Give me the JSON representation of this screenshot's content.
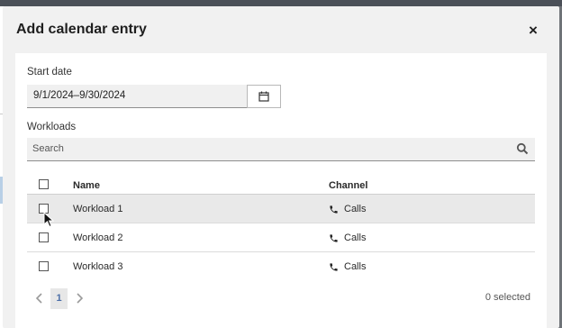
{
  "dialog": {
    "title": "Add calendar entry",
    "close_label": "×"
  },
  "start_date": {
    "label": "Start date",
    "value": "9/1/2024–9/30/2024"
  },
  "workloads": {
    "label": "Workloads",
    "search_placeholder": "Search"
  },
  "table": {
    "headers": {
      "name": "Name",
      "channel": "Channel"
    },
    "rows": [
      {
        "name": "Workload 1",
        "channel": "Calls",
        "checked": false
      },
      {
        "name": "Workload 2",
        "channel": "Calls",
        "checked": false
      },
      {
        "name": "Workload 3",
        "channel": "Calls",
        "checked": false
      }
    ]
  },
  "pagination": {
    "current_page": "1",
    "selected_text": "0 selected"
  },
  "colors": {
    "accent": "#4b6ea8",
    "row_hover": "#e9e9e9",
    "overlay": "#6f7378"
  },
  "icons": {
    "close": "close-icon",
    "calendar": "calendar-icon",
    "search": "search-icon",
    "channel": "phone-icon",
    "prev": "chevron-left-icon",
    "next": "chevron-right-icon"
  }
}
